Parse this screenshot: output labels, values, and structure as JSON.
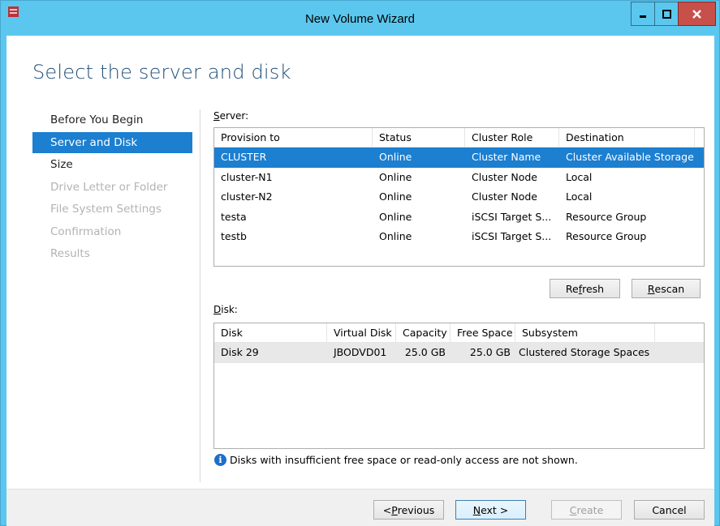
{
  "window": {
    "title": "New Volume Wizard"
  },
  "page": {
    "heading": "Select the server and disk"
  },
  "nav": {
    "items": [
      {
        "label": "Before You Begin",
        "state": "normal"
      },
      {
        "label": "Server and Disk",
        "state": "active"
      },
      {
        "label": "Size",
        "state": "normal"
      },
      {
        "label": "Drive Letter or Folder",
        "state": "disabled"
      },
      {
        "label": "File System Settings",
        "state": "disabled"
      },
      {
        "label": "Confirmation",
        "state": "disabled"
      },
      {
        "label": "Results",
        "state": "disabled"
      }
    ]
  },
  "server": {
    "label_accel": "S",
    "label_rest": "erver:",
    "columns": [
      "Provision to",
      "Status",
      "Cluster Role",
      "Destination"
    ],
    "rows": [
      [
        "CLUSTER",
        "Online",
        "Cluster Name",
        "Cluster Available Storage"
      ],
      [
        "cluster-N1",
        "Online",
        "Cluster Node",
        "Local"
      ],
      [
        "cluster-N2",
        "Online",
        "Cluster Node",
        "Local"
      ],
      [
        "testa",
        "Online",
        "iSCSI Target S...",
        "Resource Group"
      ],
      [
        "testb",
        "Online",
        "iSCSI Target S...",
        "Resource Group"
      ]
    ],
    "refresh_pre": "Re",
    "refresh_accel": "f",
    "refresh_post": "resh",
    "rescan_accel": "R",
    "rescan_post": "escan"
  },
  "disk": {
    "label_accel": "D",
    "label_rest": "isk:",
    "columns": [
      "Disk",
      "Virtual Disk",
      "Capacity",
      "Free Space",
      "Subsystem"
    ],
    "rows": [
      [
        "Disk 29",
        "JBODVD01",
        "25.0 GB",
        "25.0 GB",
        "Clustered Storage Spaces"
      ]
    ]
  },
  "info": {
    "icon_glyph": "i",
    "message": "Disks with insufficient free space or read-only access are not shown."
  },
  "footer": {
    "previous_pre": "< ",
    "previous_accel": "P",
    "previous_post": "revious",
    "next_accel": "N",
    "next_post": "ext >",
    "create_accel": "C",
    "create_post": "reate",
    "cancel_label": "Cancel"
  },
  "colors": {
    "titlebar": "#5bc7ee",
    "accent": "#1c7fd0",
    "close": "#c7504a",
    "heading": "#1e4e79"
  }
}
